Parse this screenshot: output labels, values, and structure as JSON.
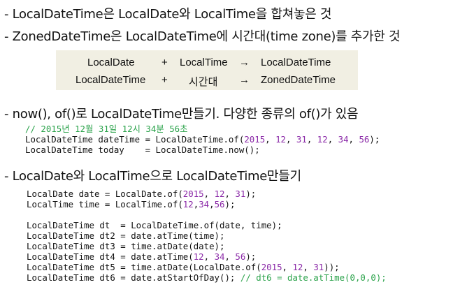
{
  "bullets": {
    "b1": "- LocalDateTime은 LocalDate와 LocalTime을 합쳐놓은 것",
    "b2": "- ZonedDateTime은 LocalDateTime에 시간대(time zone)를 추가한 것",
    "b3": "- now(), of()로 LocalDateTime만들기. 다양한 종류의 of()가 있음",
    "b4": "- LocalDate와 LocalTime으로 LocalDateTime만들기"
  },
  "table": {
    "row1": [
      "LocalDate",
      "+",
      "LocalTime",
      "→",
      "LocalDateTime"
    ],
    "row2": [
      "LocalDateTime",
      "+",
      "시간대",
      "→",
      "ZonedDateTime"
    ]
  },
  "code1": {
    "comment": "// 2015년 12월 31일 12시 34분 56초",
    "l1_a": "LocalDateTime dateTime = LocalDateTime.of(",
    "l1_n1": "2015",
    "l1_n2": "12",
    "l1_n3": "31",
    "l1_n4": "12",
    "l1_n5": "34",
    "l1_n6": "56",
    "l1_end": ");",
    "l2": "LocalDateTime today    = LocalDateTime.now();"
  },
  "code2": {
    "l1_a": "LocalDate date = LocalDate.of(",
    "l1_n1": "2015",
    "l1_n2": "12",
    "l1_n3": "31",
    "l1_end": ");",
    "l2_a": "LocalTime time = LocalTime.of(",
    "l2_n1": "12",
    "l2_n2": "34",
    "l2_n3": "56",
    "l2_end": ");",
    "l3": "LocalDateTime dt  = LocalDateTime.of(date, time);",
    "l4": "LocalDateTime dt2 = date.atTime(time);",
    "l5": "LocalDateTime dt3 = time.atDate(date);",
    "l6_a": "LocalDateTime dt4 = date.atTime(",
    "l6_n1": "12",
    "l6_n2": "34",
    "l6_n3": "56",
    "l6_end": ");",
    "l7_a": "LocalDateTime dt5 = time.atDate(LocalDate.of(",
    "l7_n1": "2015",
    "l7_n2": "12",
    "l7_n3": "31",
    "l7_end": "));",
    "l8_a": "LocalDateTime dt6 = date.atStartOfDay(); ",
    "l8_cmt": "// dt6 = date.atTime(0,0,0);"
  }
}
